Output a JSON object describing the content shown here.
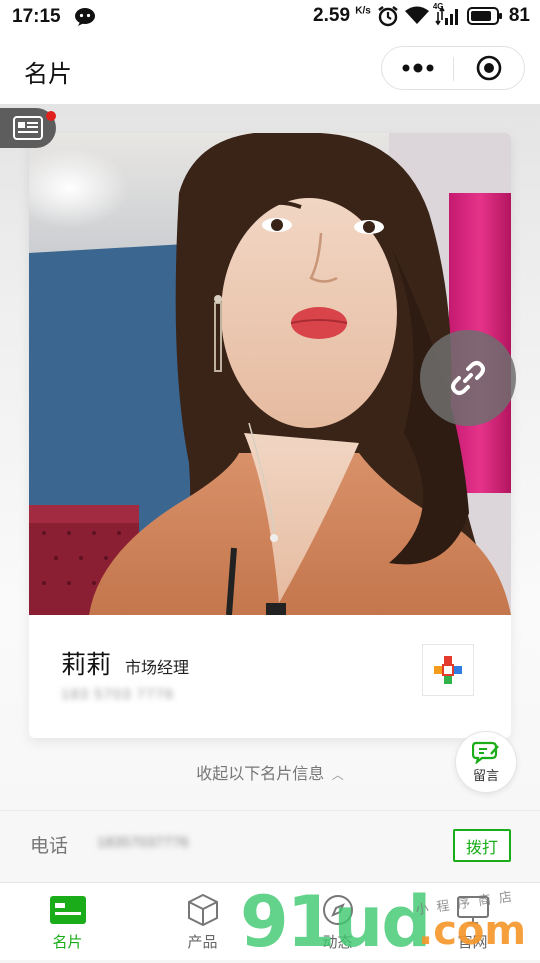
{
  "status_bar": {
    "time": "17:15",
    "network_speed": "2.59",
    "speed_unit": "K/s",
    "network_type": "4G",
    "battery": "81"
  },
  "header": {
    "title": "名片"
  },
  "card": {
    "name": "莉莉",
    "position": "市场经理",
    "phone": "183 5703 7776"
  },
  "collapse_label": "收起以下名片信息",
  "message_button_label": "留言",
  "phone_row": {
    "label": "电话",
    "value": "18357037776",
    "dial_label": "拨打"
  },
  "tabs": [
    {
      "label": "名片",
      "icon": "card-icon",
      "active": true
    },
    {
      "label": "产品",
      "icon": "box-icon",
      "active": false
    },
    {
      "label": "动态",
      "icon": "compass-icon",
      "active": false
    },
    {
      "label": "官网",
      "icon": "monitor-icon",
      "active": false
    }
  ],
  "watermark": {
    "main": "91ud",
    "suffix": ".com",
    "cn": "小程序商店"
  },
  "colors": {
    "accent": "#1aad19",
    "badge": "#e0201c"
  }
}
